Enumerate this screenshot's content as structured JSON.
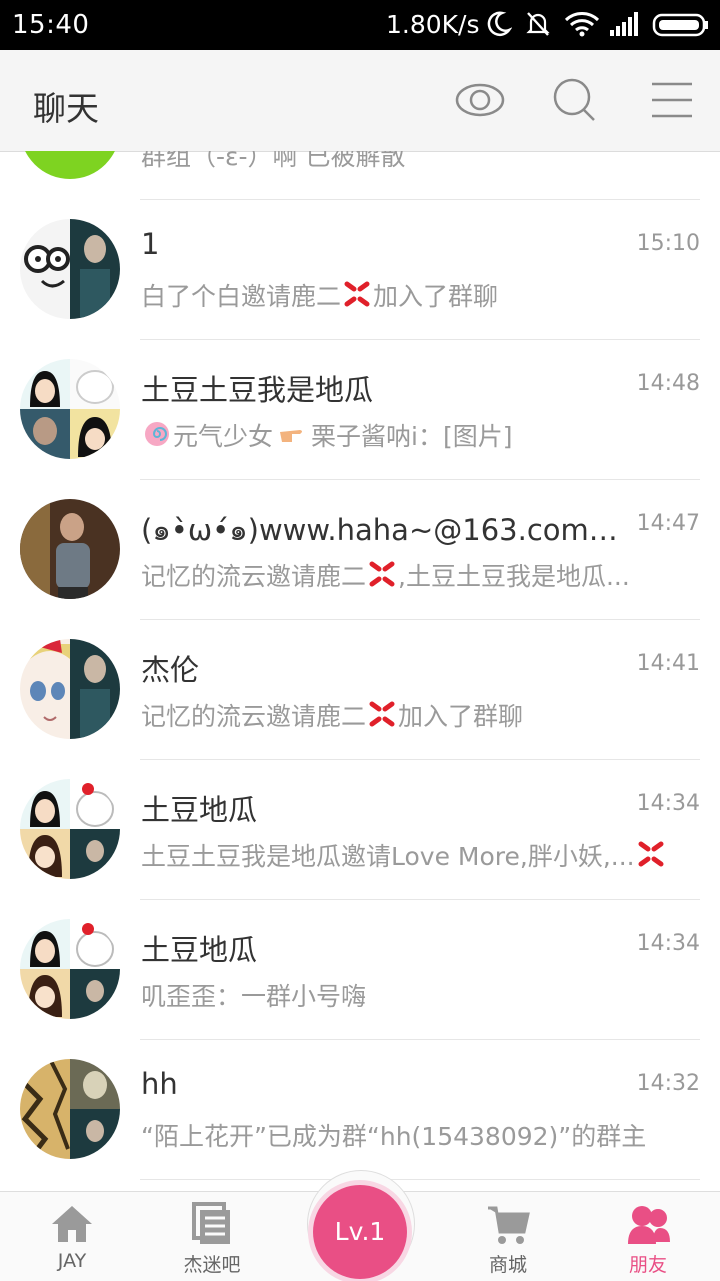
{
  "status": {
    "time": "15:40",
    "speed": "1.80K/s"
  },
  "header": {
    "title": "聊天",
    "icons": [
      "eye-icon",
      "search-icon",
      "menu-icon"
    ]
  },
  "chats": [
    {
      "name": "",
      "time": "",
      "message": "群组（-ε-）啊 已被解散"
    },
    {
      "name": "1",
      "time": "15:10",
      "message_a": "白了个白邀请鹿二",
      "message_b": "加入了群聊"
    },
    {
      "name": "土豆土豆我是地瓜",
      "time": "14:48",
      "message_a": "元气少女",
      "message_b": "栗子酱呐i：[图片]"
    },
    {
      "name": "(๑•̀ω•́๑)www.haha~@163.com你...",
      "time": "14:47",
      "message_a": "记忆的流云邀请鹿二",
      "message_b": ",土豆土豆我是地瓜..."
    },
    {
      "name": "杰伦",
      "time": "14:41",
      "message_a": "记忆的流云邀请鹿二",
      "message_b": "加入了群聊"
    },
    {
      "name": "土豆地瓜",
      "time": "14:34",
      "message_a": "土豆土豆我是地瓜邀请Love  More,胖小妖,...",
      "message_b": ""
    },
    {
      "name": "土豆地瓜",
      "time": "14:34",
      "message": "叽歪歪：一群小号嗨"
    },
    {
      "name": "hh",
      "time": "14:32",
      "message": "“陌上花开”已成为群“hh(15438092)”的群主"
    }
  ],
  "tabs": [
    {
      "label": "JAY",
      "icon": "home-icon"
    },
    {
      "label": "杰迷吧",
      "icon": "forum-icon"
    },
    {
      "label": "Lv.1",
      "icon": "level-badge"
    },
    {
      "label": "商城",
      "icon": "cart-icon"
    },
    {
      "label": "朋友",
      "icon": "friends-icon"
    }
  ],
  "colors": {
    "accent": "#e94f85",
    "green_avatar": "#7ed321"
  }
}
